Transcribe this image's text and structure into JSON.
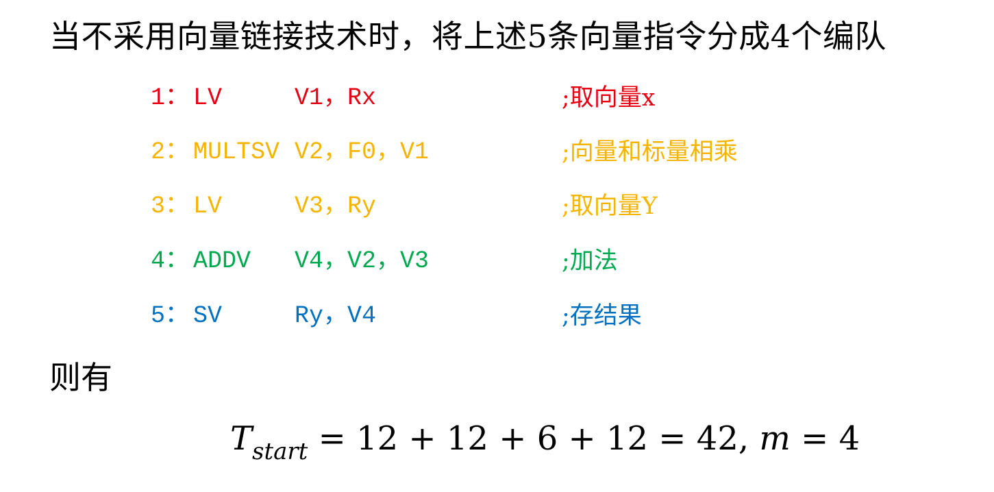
{
  "heading": "当不采用向量链接技术时，将上述5条向量指令分成4个编队",
  "instructions": [
    {
      "num": "1：",
      "op": "LV",
      "args": "V1，Rx",
      "comment": ";取向量x",
      "color": "#e60012"
    },
    {
      "num": "2：",
      "op": "MULTSV",
      "args": "V2，F0，V1",
      "comment": ";向量和标量相乘",
      "color": "#f5b400"
    },
    {
      "num": "3：",
      "op": "LV",
      "args": "V3，Ry",
      "comment": ";取向量Y",
      "color": "#f5b400"
    },
    {
      "num": "4：",
      "op": "ADDV",
      "args": "V4，V2，V3",
      "comment": ";加法",
      "color": "#00a94f"
    },
    {
      "num": "5：",
      "op": "SV",
      "args": "Ry，V4",
      "comment": ";存结果",
      "color": "#0070c0"
    }
  ],
  "then_label": "则有",
  "formula": {
    "var": "T",
    "sub": "start",
    "expression": "= 12 + 12 + 6 + 12 = 42,",
    "m_var": "m",
    "m_value": "= 4"
  }
}
